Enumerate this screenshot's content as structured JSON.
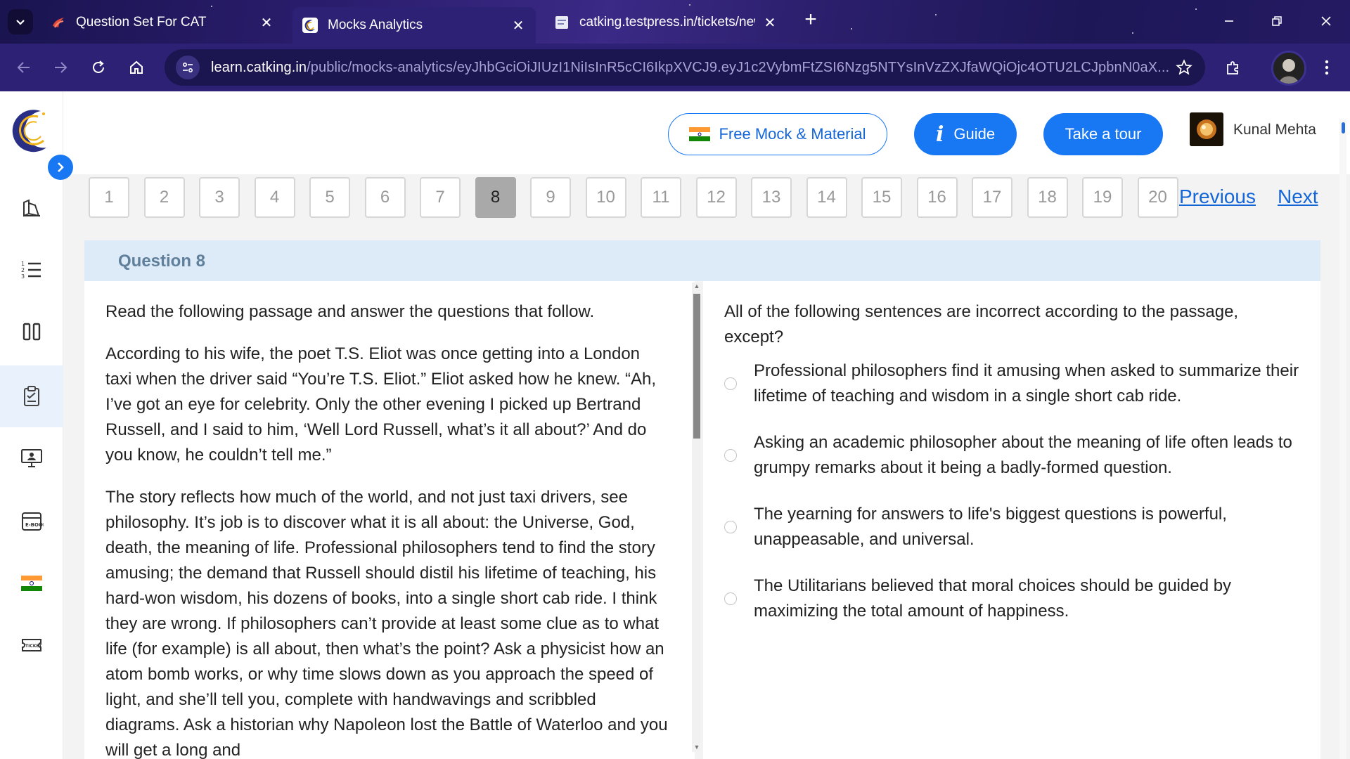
{
  "browser": {
    "tabs": [
      {
        "title": "Question Set For CAT",
        "favicon": "cat-logo-icon",
        "active": false
      },
      {
        "title": "Mocks Analytics",
        "favicon": "catking-moon-icon",
        "active": true
      },
      {
        "title": "catking.testpress.in/tickets/new",
        "favicon": "document-icon",
        "active": false
      }
    ],
    "url_host": "learn.catking.in",
    "url_path": "/public/mocks-analytics/eyJhbGciOiJIUzI1NiIsInR5cCI6IkpXVCJ9.eyJ1c2VybmFtZSI6Nzg5NTYsInVzZXJfaWQiOjc4OTU2LCJpbnN0aX..."
  },
  "header": {
    "free_mock_label": "Free Mock & Material",
    "guide_label": "Guide",
    "tour_label": "Take a tour",
    "user_name": "Kunal Mehta"
  },
  "question_nav": {
    "numbers": [
      "1",
      "2",
      "3",
      "4",
      "5",
      "6",
      "7",
      "8",
      "9",
      "10",
      "11",
      "12",
      "13",
      "14",
      "15",
      "16",
      "17",
      "18",
      "19",
      "20"
    ],
    "current": "8",
    "previous_label": "Previous",
    "next_label": "Next"
  },
  "question": {
    "header": "Question 8",
    "passage": [
      "Read the following passage and answer the questions that follow.",
      "According to his wife, the poet T.S. Eliot was once getting into a London taxi when the driver said “You’re T.S. Eliot.” Eliot asked how he knew. “Ah, I’ve got an eye for celebrity. Only the other evening I picked up Bertrand Russell, and I said to him, ‘Well Lord Russell, what’s it all about?’ And do you know, he couldn’t tell me.”",
      "The story reflects how much of the world, and not just taxi drivers, see philosophy. It’s job is to discover what it is all about: the Universe, God, death, the meaning of life. Professional philosophers tend to find the story amusing; the demand that Russell should distil his lifetime of teaching, his hard-won wisdom, his dozens of books, into a single short cab ride. I think they are wrong. If philosophers can’t provide at least some clue as to what life (for example) is all about, then what’s the point? Ask a physicist how an atom bomb works, or why time slows down as you approach the speed of light, and she’ll tell you, complete with handwavings and scribbled diagrams. Ask a historian why Napoleon lost the Battle of Waterloo and you will get a long and"
    ],
    "prompt": "All of the following sentences are incorrect according to the passage, except?",
    "options": [
      "Professional philosophers find it amusing when asked to summarize their lifetime of teaching and wisdom in a single short cab ride.",
      "Asking an academic philosopher about the meaning of life often leads to grumpy remarks about it being a badly-formed question.",
      "The yearning for answers to life's biggest questions is powerful, unappeasable, and universal.",
      "The Utilitarians believed that moral choices should be guided by maximizing the total amount of happiness."
    ]
  },
  "sidebar": {
    "items": [
      "books-icon",
      "numbered-list-icon",
      "columns-icon",
      "clipboard-icon",
      "monitor-icon",
      "ebook-icon",
      "india-flag-icon",
      "ticket-icon"
    ],
    "active_index": 3
  },
  "colors": {
    "brand_blue": "#1877f2",
    "question_header_bg": "#ddeaf8",
    "chrome_bg": "#2d2175"
  }
}
